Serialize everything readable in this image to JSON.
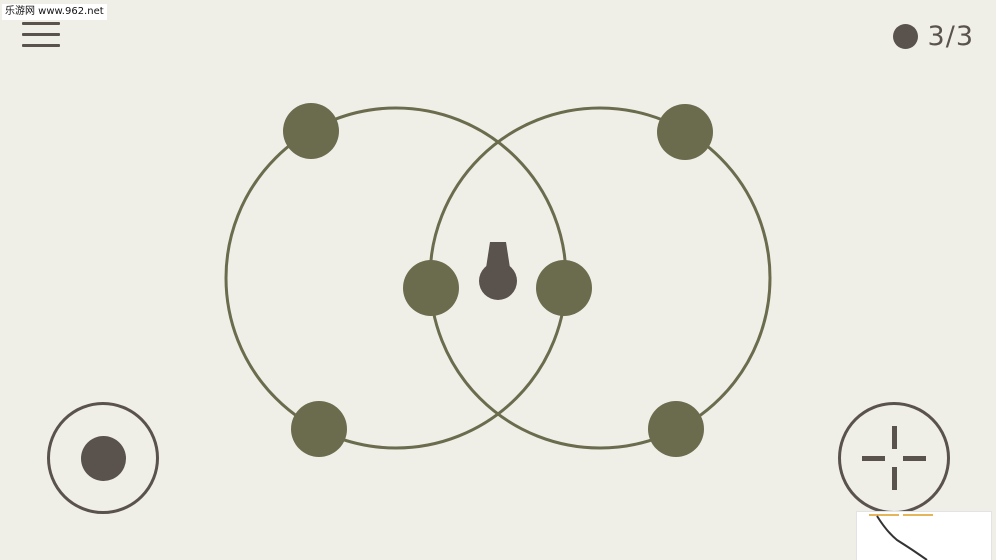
{
  "watermark": {
    "text": "乐游网 www.962.net"
  },
  "hud": {
    "ammo_current": 3,
    "ammo_total": 3,
    "ammo_text": "3/3"
  },
  "colors": {
    "background": "#efefe7",
    "orbit": "#6b6c4e",
    "enemy": "#6b6c4e",
    "player": "#5a524c",
    "ui": "#5a524c"
  },
  "icons": {
    "menu": "hamburger-menu-icon",
    "ammo": "ammo-dot-icon",
    "fire": "crosshair-icon"
  }
}
